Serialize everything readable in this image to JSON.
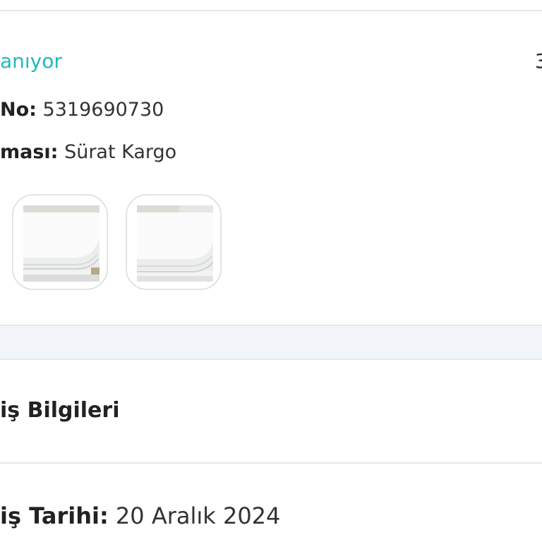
{
  "shipment": {
    "status": "anıyor",
    "right_value": "3",
    "tracking_label": "No:",
    "tracking_value": "5319690730",
    "carrier_label": "ması:",
    "carrier_value": "Sürat Kargo",
    "thumbnails": [
      {
        "icon": "mattress-protector-image"
      },
      {
        "icon": "mattress-protector-image"
      }
    ]
  },
  "order_info": {
    "title": "iş Bilgileri",
    "date_label": "iş Tarihi:",
    "date_value": "20 Aralık 2024"
  },
  "colors": {
    "accent": "#22b8bd",
    "band": "#f2f5fa"
  }
}
